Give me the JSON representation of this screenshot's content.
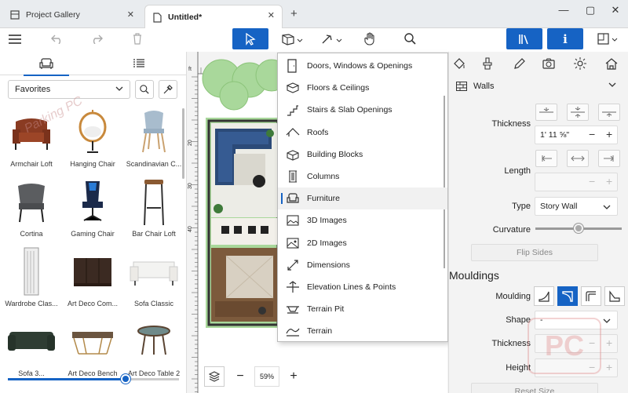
{
  "tabs": [
    {
      "label": "Project Gallery",
      "active": false
    },
    {
      "label": "Untitled*",
      "active": true
    }
  ],
  "window": {
    "minimize": "—",
    "maximize": "▢",
    "close": "✕"
  },
  "left_panel": {
    "favorites_label": "Favorites",
    "items": [
      {
        "label": "Armchair Loft"
      },
      {
        "label": "Hanging Chair"
      },
      {
        "label": "Scandinavian C..."
      },
      {
        "label": "Cortina"
      },
      {
        "label": "Gaming Chair"
      },
      {
        "label": "Bar Chair Loft"
      },
      {
        "label": "Wardrobe Clas..."
      },
      {
        "label": "Art Deco Com..."
      },
      {
        "label": "Sofa Classic"
      },
      {
        "label": "Sofa 3..."
      },
      {
        "label": "Art Deco Bench"
      },
      {
        "label": "Art Deco Table 2"
      }
    ],
    "slider_value": 0.69
  },
  "canvas": {
    "ruler_unit": "ft",
    "ruler_marks": [
      "20",
      "30",
      "40"
    ],
    "zoom_level": "59%",
    "zoom_minus": "−",
    "zoom_plus": "+"
  },
  "dropdown": {
    "items": [
      {
        "label": "Doors, Windows & Openings",
        "icon": "door-icon"
      },
      {
        "label": "Floors & Ceilings",
        "icon": "floor-icon"
      },
      {
        "label": "Stairs & Slab Openings",
        "icon": "stairs-icon"
      },
      {
        "label": "Roofs",
        "icon": "roof-icon"
      },
      {
        "label": "Building Blocks",
        "icon": "block-icon"
      },
      {
        "label": "Columns",
        "icon": "column-icon"
      },
      {
        "label": "Furniture",
        "icon": "furniture-icon",
        "selected": true
      },
      {
        "label": "3D Images",
        "icon": "image3d-icon"
      },
      {
        "label": "2D Images",
        "icon": "image2d-icon"
      },
      {
        "label": "Dimensions",
        "icon": "dimension-icon"
      },
      {
        "label": "Elevation Lines & Points",
        "icon": "elevation-icon"
      },
      {
        "label": "Terrain Pit",
        "icon": "terrain-pit-icon"
      },
      {
        "label": "Terrain",
        "icon": "terrain-icon"
      }
    ]
  },
  "right_panel": {
    "object_type": "Walls",
    "thickness_label": "Thickness",
    "thickness_value": "1' 11 ⅝\"",
    "length_label": "Length",
    "type_label": "Type",
    "type_value": "Story Wall",
    "curvature_label": "Curvature",
    "curvature_value": 0.5,
    "flip_sides": "Flip Sides",
    "mouldings_title": "Mouldings",
    "moulding_label": "Moulding",
    "shape_label": "Shape",
    "shape_value": "-",
    "m_thickness_label": "Thickness",
    "height_label": "Height",
    "reset_size": "Reset Size",
    "minus": "−",
    "plus": "+"
  },
  "watermark": {
    "text": "PC",
    "side_text": "Parking PC"
  },
  "colors": {
    "accent": "#1663c4",
    "wall": "#2b4a78",
    "floor": "#7c5a3c",
    "grass": "#a9d89b"
  }
}
